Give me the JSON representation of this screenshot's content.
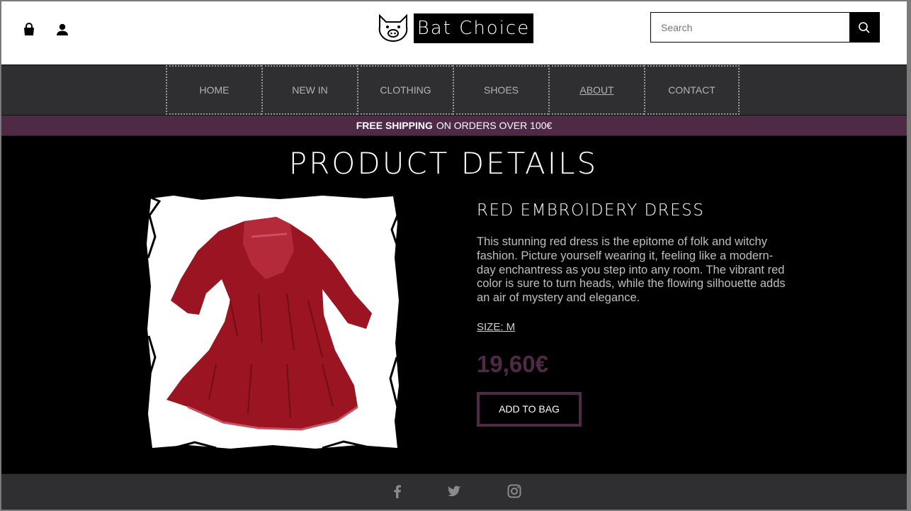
{
  "header": {
    "brand": "Bat Choice",
    "icons": [
      "shopping-bag-icon",
      "user-icon"
    ],
    "search_placeholder": "Search"
  },
  "nav": {
    "items": [
      {
        "label": "HOME"
      },
      {
        "label": "NEW IN"
      },
      {
        "label": "CLOTHING"
      },
      {
        "label": "SHOES"
      },
      {
        "label": "ABOUT",
        "active": true
      },
      {
        "label": "CONTACT"
      }
    ]
  },
  "banner": {
    "bold": "FREE SHIPPING",
    "rest": "ON ORDERS OVER 100€"
  },
  "main": {
    "title": "PRODUCT DETAILS",
    "product": {
      "name": "RED EMBROIDERY DRESS",
      "description": "This stunning red dress is the epitome of folk and witchy fashion. Picture yourself wearing it, feeling like a modern-day enchantress as you step into any room. The vibrant red color is sure to turn heads, while the flowing silhouette adds an air of mystery and elegance.",
      "size": "SIZE: M",
      "price": "19,60€",
      "add_button": "ADD TO BAG"
    }
  },
  "footer": {
    "social_icons": [
      "facebook-icon",
      "twitter-icon",
      "instagram-icon"
    ]
  },
  "colors": {
    "accent": "#4f2a47",
    "nav_bg": "#2f2f31",
    "dress": "#9b1422"
  }
}
